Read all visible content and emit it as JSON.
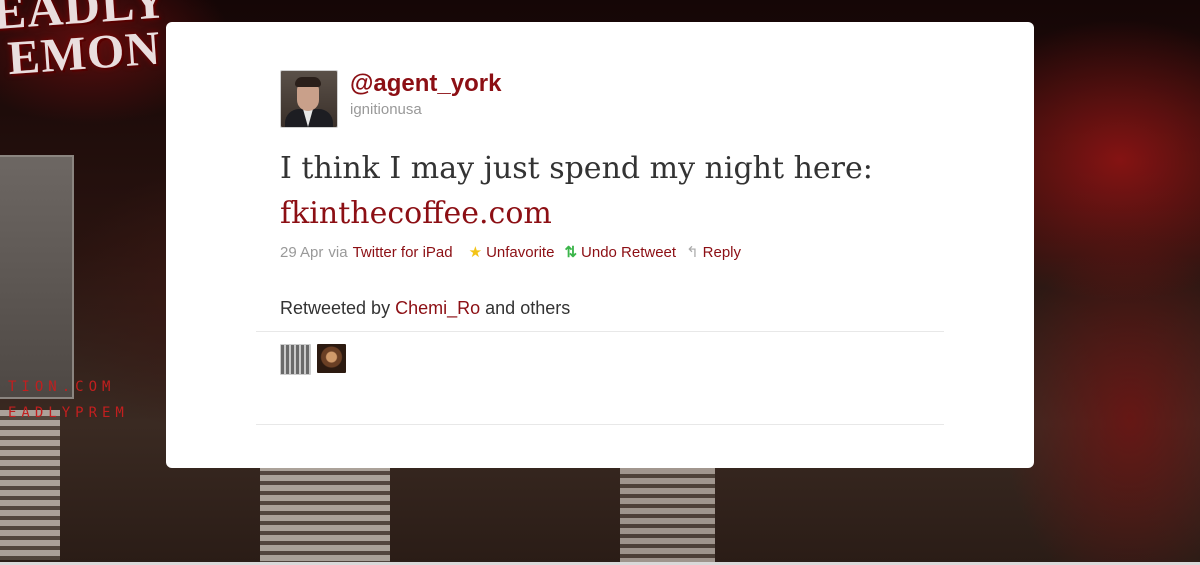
{
  "background": {
    "logo_line1": "EADLY",
    "logo_line2": "EMON",
    "url_line1": "TION.COM",
    "url_line2": "EADLYPREM"
  },
  "tweet": {
    "screen_name": "@agent_york",
    "user_name": "ignitionusa",
    "text": "I think I may just spend my night here:",
    "link_text": "fkinthecoffee.com",
    "date": "29 Apr",
    "via_label": "via",
    "source": "Twitter for iPad",
    "actions": {
      "unfavorite": "Unfavorite",
      "undo_retweet": "Undo Retweet",
      "reply": "Reply"
    },
    "retweeted_by_prefix": "Retweeted by",
    "retweeted_by_user": "Chemi_Ro",
    "retweeted_by_suffix": "and others"
  },
  "icons": {
    "star": "star-icon",
    "retweet": "retweet-icon",
    "reply": "reply-icon"
  },
  "colors": {
    "accent": "#8c0f14",
    "favorite": "#f3c316",
    "retweet": "#3bb54a",
    "muted": "#999999",
    "text": "#333333"
  }
}
